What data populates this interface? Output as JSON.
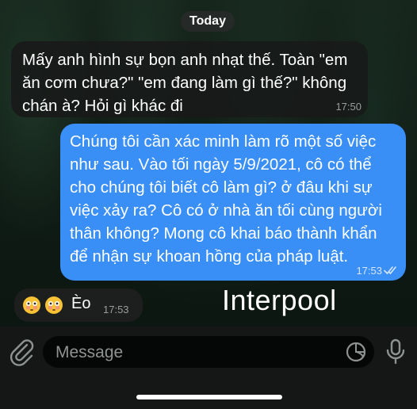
{
  "chat": {
    "date_label": "Today",
    "messages": [
      {
        "direction": "incoming",
        "lines": [
          "Mấy anh hình sự bọn anh nhạt thế. Toàn \"em",
          "ăn cơm chưa?\" \"em đang làm gì thế?\" không",
          "chán à? Hỏi gì khác đi"
        ],
        "time": "17:50"
      },
      {
        "direction": "outgoing",
        "lines": [
          "Chúng tôi cần xác minh làm rõ một số việc",
          "như sau. Vào tối ngày 5/9/2021, cô có thể",
          "cho chúng tôi biết cô làm gì? ở đâu khi sự",
          "việc xảy ra? Cô có ở nhà ăn tối cùng người",
          "thân không? Mong cô khai báo thành khẩn",
          "để nhận sự khoan hồng của pháp luật."
        ],
        "time": "17:53",
        "read_icon": "double-check-icon"
      },
      {
        "direction": "incoming",
        "emojis": [
          "flushed-face",
          "flushed-face"
        ],
        "text": "Èo",
        "time": "17:53"
      }
    ]
  },
  "watermark": "Interpool",
  "composer": {
    "placeholder": "Message",
    "attach_icon": "paperclip-icon",
    "sticker_icon": "sticker-icon",
    "mic_icon": "microphone-icon"
  },
  "colors": {
    "outgoing_bubble": "#3a8ff6",
    "incoming_bubble": "#181a19",
    "background": "#0d1511"
  }
}
